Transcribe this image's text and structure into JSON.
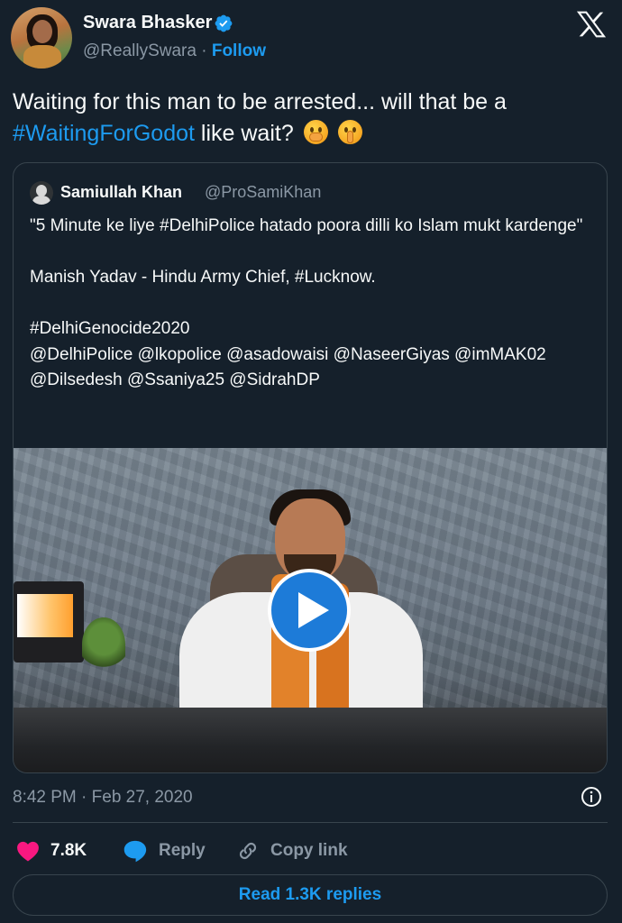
{
  "author": {
    "name": "Swara Bhasker",
    "handle": "@ReallySwara",
    "separator": "·",
    "follow_label": "Follow",
    "verified": true
  },
  "tweet": {
    "text_part1": "Waiting for this man to be arrested... will that be a ",
    "hashtag": "#WaitingForGodot",
    "text_part2": " like wait?",
    "emojis": [
      "face-with-hand-over-mouth-emoji",
      "shushing-face-emoji"
    ]
  },
  "quoted_tweet": {
    "name": "Samiullah Khan",
    "handle": "@ProSamiKhan",
    "text": "\"5 Minute ke liye #DelhiPolice hatado poora dilli ko Islam mukt kardenge\"\n\nManish Yadav - Hindu Army Chief, #Lucknow.\n\n#DelhiGenocide2020\n@DelhiPolice @lkopolice @asadowaisi @NaseerGiyas @imMAK02\n@Dilsedesh @Ssaniya25 @SidrahDP",
    "media": {
      "type": "video",
      "icon": "play-icon"
    }
  },
  "timestamp": "8:42 PM · Feb 27, 2020",
  "actions": {
    "like_count": "7.8K",
    "reply_label": "Reply",
    "copy_link_label": "Copy link"
  },
  "read_replies_label": "Read 1.3K replies",
  "colors": {
    "background": "#15202b",
    "accent": "#1d9bf0",
    "like": "#f91880",
    "muted": "#8b98a5",
    "border": "#38444d"
  }
}
